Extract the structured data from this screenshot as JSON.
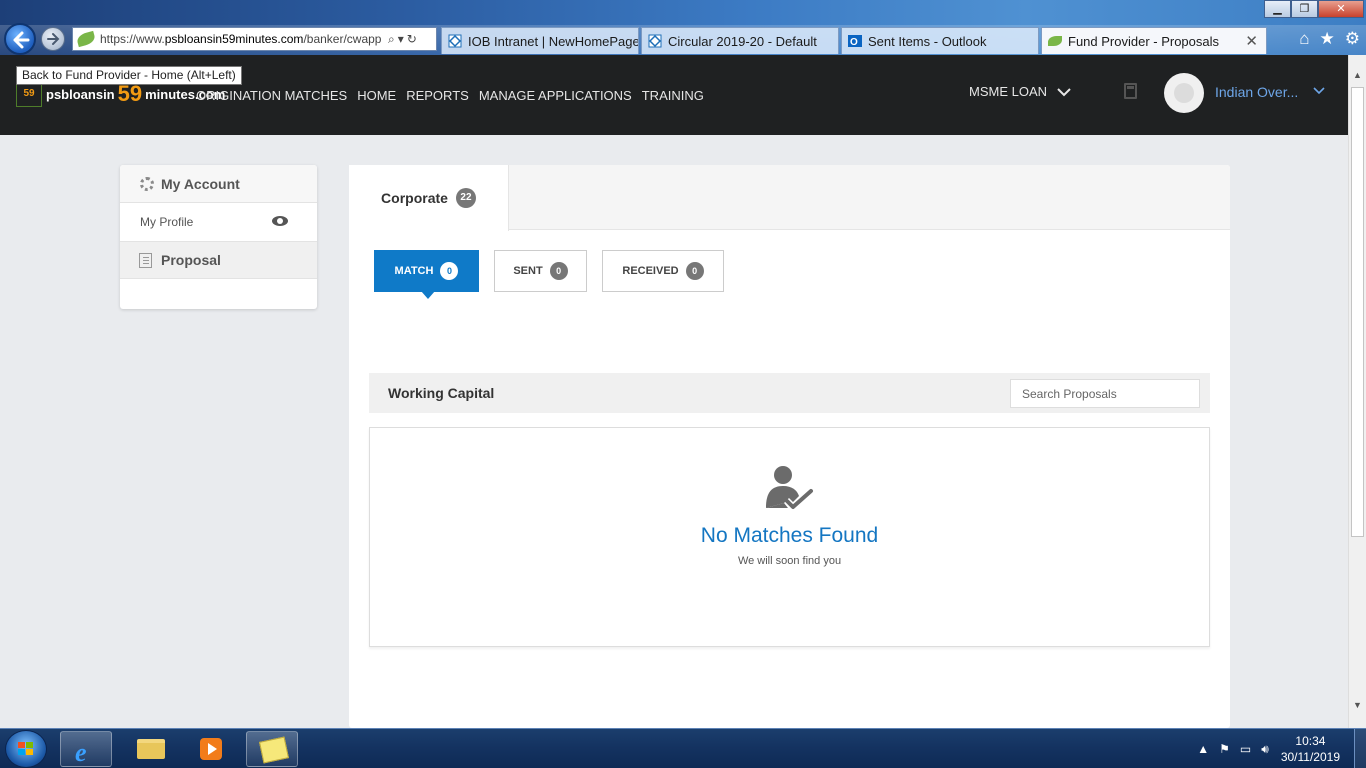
{
  "browser": {
    "tooltip": "Back to Fund Provider - Home (Alt+Left)",
    "url_prefix": "https://www.",
    "url_domain": "psbloansin59minutes.com",
    "url_path": "/banker/cwapp",
    "tabs": [
      {
        "label": "IOB Intranet | NewHomePage"
      },
      {
        "label": "Circular 2019-20 - Default"
      },
      {
        "label": "Sent Items - Outlook"
      },
      {
        "label": "Fund Provider - Proposals"
      }
    ],
    "win_minimize": "▁",
    "win_restore": "❐",
    "win_close": "✕",
    "tab_close": "✕",
    "home_icon": "⌂",
    "star_icon": "★",
    "gear_icon": "⚙"
  },
  "header": {
    "logo_badge": "59",
    "logo_brand": "psbloansin",
    "logo_num": "59",
    "logo_suffix": "minutes.com",
    "nav": [
      "ORIGINATION MATCHES",
      "HOME",
      "REPORTS",
      "MANAGE APPLICATIONS",
      "TRAINING"
    ],
    "loan_type": "MSME LOAN",
    "user_name": "Indian Over..."
  },
  "sidebar": {
    "account_label": "My Account",
    "profile_label": "My Profile",
    "proposal_label": "Proposal"
  },
  "main": {
    "tab_label": "Corporate",
    "tab_count": "22",
    "subtabs": [
      {
        "label": "MATCH",
        "count": "0"
      },
      {
        "label": "SENT",
        "count": "0"
      },
      {
        "label": "RECEIVED",
        "count": "0"
      }
    ],
    "section_title": "Working Capital",
    "search_placeholder": "Search Proposals",
    "empty_title": "No Matches Found",
    "empty_subtitle": "We will soon find you"
  },
  "taskbar": {
    "time": "10:34",
    "date": "30/11/2019",
    "tray_up": "▲"
  },
  "colors": {
    "accent": "#0f7ac8",
    "header_bg": "#1f2122",
    "logo_orange": "#f29b13",
    "user_link": "#6ea6e8"
  }
}
